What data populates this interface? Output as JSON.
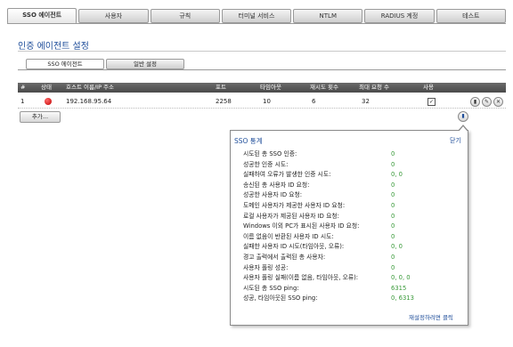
{
  "tabs": [
    "SSO 에이전트",
    "사용자",
    "규칙",
    "터미널 서비스",
    "NTLM",
    "RADIUS 계정",
    "테스트"
  ],
  "page_title": "인증 에이전트 설정",
  "subtabs": [
    "SSO 에이전트",
    "일반 설정"
  ],
  "table": {
    "headers": [
      "#",
      "상태",
      "호스트 이름/IP 주소",
      "포트",
      "타임아웃",
      "재시도 횟수",
      "최대 요청 수",
      "사용"
    ],
    "rows": [
      {
        "num": "1",
        "host": "192.168.95.64",
        "port": "2258",
        "timeout": "10",
        "retries": "6",
        "max_requests": "32"
      }
    ]
  },
  "add_button": "추가...",
  "popup": {
    "title": "SSO 통계",
    "close": "닫기",
    "reset": "재설정하려면 클릭",
    "stats": [
      {
        "label": "시도된 총 SSO 인증:",
        "value": "0"
      },
      {
        "label": "성공한 인증 시도:",
        "value": "0"
      },
      {
        "label": "실패하여 오류가 발생한 인증 시도:",
        "value": "0, 0"
      },
      {
        "label": "송신된 총 사용자 ID 요청:",
        "value": "0"
      },
      {
        "label": "성공한 사용자 ID 요청:",
        "value": "0"
      },
      {
        "label": "도메인 사용자가 제공한 사용자 ID 요청:",
        "value": "0"
      },
      {
        "label": "로컬 사용자가 제공된 사용자 ID 요청:",
        "value": "0"
      },
      {
        "label": "Windows 이외 PC가 표시된 사용자 ID 요청:",
        "value": "0"
      },
      {
        "label": "이름 없음이 반환된 사용자 ID 시도:",
        "value": "0"
      },
      {
        "label": "실패한 사용자 ID 시도(타임아웃, 오류):",
        "value": "0, 0"
      },
      {
        "label": "경고 출력에서 출력된 총 사용자:",
        "value": "0"
      },
      {
        "label": "사용자 폴링 성공:",
        "value": "0"
      },
      {
        "label": "사용자 폴링 실패(이름 없음, 타임아웃, 오류):",
        "value": "0, 0, 0"
      },
      {
        "label": "시도된 총 SSO ping:",
        "value": "6315"
      },
      {
        "label": "성공, 타임아웃된 SSO ping:",
        "value": "0, 6313"
      }
    ]
  }
}
